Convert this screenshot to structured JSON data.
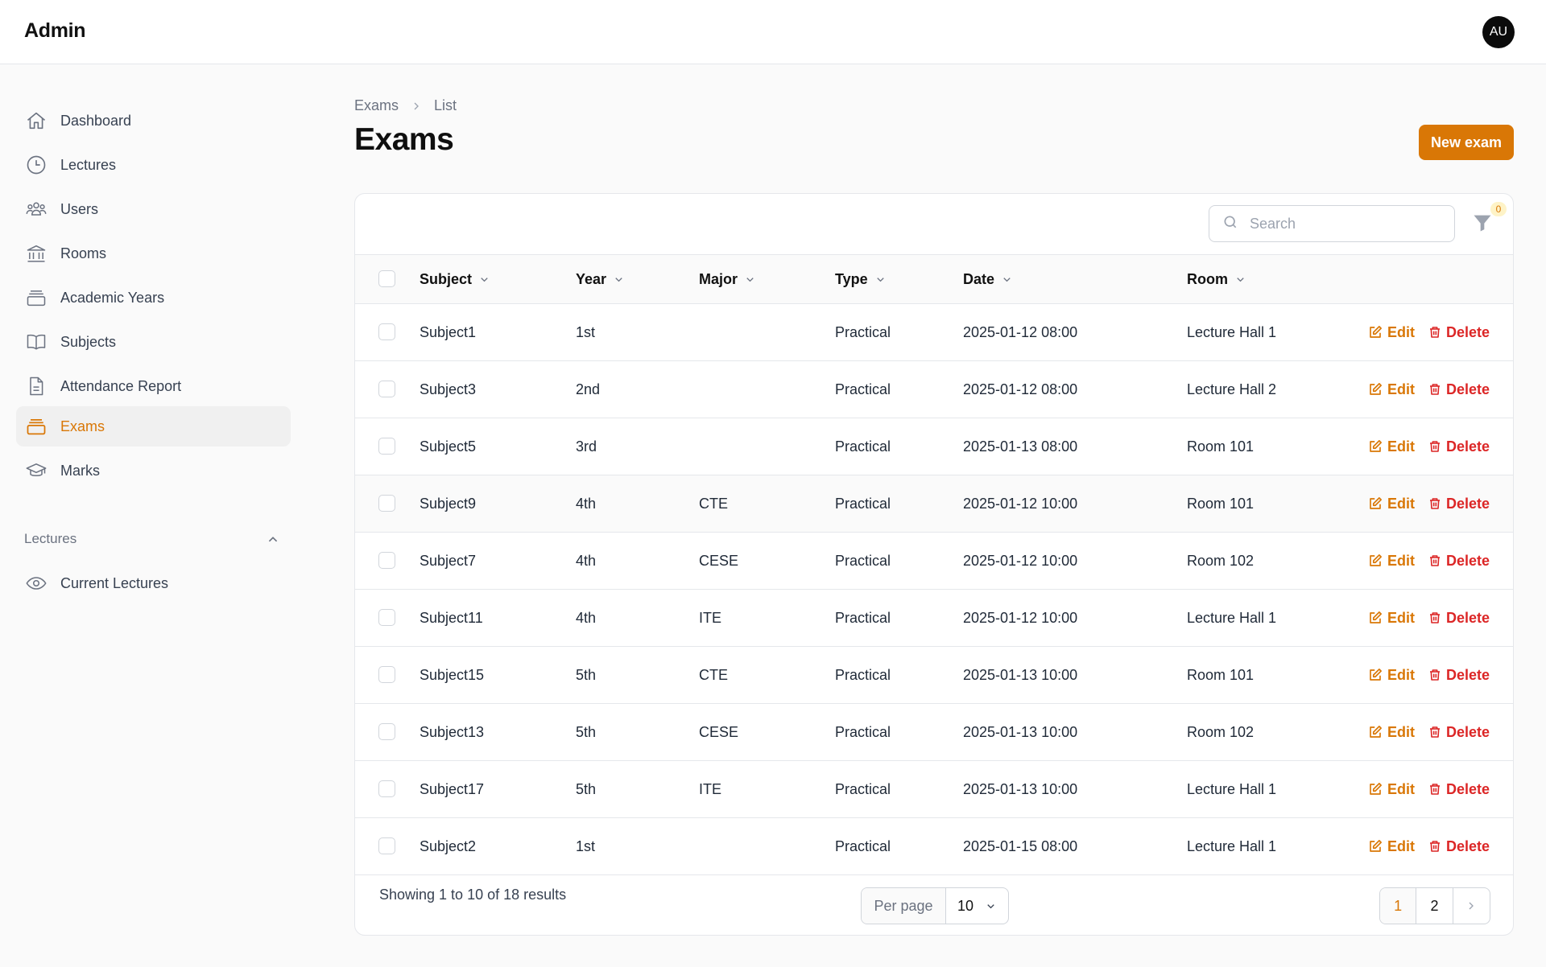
{
  "app": {
    "brand": "Admin",
    "avatar_initials": "AU",
    "accent": "#d97706"
  },
  "sidebar": {
    "items": [
      {
        "label": "Dashboard",
        "icon": "home-icon"
      },
      {
        "label": "Lectures",
        "icon": "clock-icon"
      },
      {
        "label": "Users",
        "icon": "users-icon"
      },
      {
        "label": "Rooms",
        "icon": "building-icon"
      },
      {
        "label": "Academic Years",
        "icon": "archive-icon"
      },
      {
        "label": "Subjects",
        "icon": "book-icon"
      },
      {
        "label": "Attendance Report",
        "icon": "document-icon"
      },
      {
        "label": "Exams",
        "icon": "archive-icon",
        "active": true
      },
      {
        "label": "Marks",
        "icon": "graduation-cap-icon"
      }
    ],
    "group": {
      "label": "Lectures",
      "items": [
        {
          "label": "Current Lectures",
          "icon": "eye-icon"
        }
      ]
    }
  },
  "breadcrumb": {
    "parent": "Exams",
    "current": "List"
  },
  "page": {
    "title": "Exams",
    "new_button": "New exam"
  },
  "table": {
    "search_placeholder": "Search",
    "filter_count": "0",
    "columns": [
      "Subject",
      "Year",
      "Major",
      "Type",
      "Date",
      "Room"
    ],
    "edit_label": "Edit",
    "delete_label": "Delete",
    "rows": [
      {
        "subject": "Subject1",
        "year": "1st",
        "major": "",
        "type": "Practical",
        "date": "2025-01-12 08:00",
        "room": "Lecture Hall 1"
      },
      {
        "subject": "Subject3",
        "year": "2nd",
        "major": "",
        "type": "Practical",
        "date": "2025-01-12 08:00",
        "room": "Lecture Hall 2"
      },
      {
        "subject": "Subject5",
        "year": "3rd",
        "major": "",
        "type": "Practical",
        "date": "2025-01-13 08:00",
        "room": "Room 101"
      },
      {
        "subject": "Subject9",
        "year": "4th",
        "major": "CTE",
        "type": "Practical",
        "date": "2025-01-12 10:00",
        "room": "Room 101"
      },
      {
        "subject": "Subject7",
        "year": "4th",
        "major": "CESE",
        "type": "Practical",
        "date": "2025-01-12 10:00",
        "room": "Room 102"
      },
      {
        "subject": "Subject11",
        "year": "4th",
        "major": "ITE",
        "type": "Practical",
        "date": "2025-01-12 10:00",
        "room": "Lecture Hall 1"
      },
      {
        "subject": "Subject15",
        "year": "5th",
        "major": "CTE",
        "type": "Practical",
        "date": "2025-01-13 10:00",
        "room": "Room 101"
      },
      {
        "subject": "Subject13",
        "year": "5th",
        "major": "CESE",
        "type": "Practical",
        "date": "2025-01-13 10:00",
        "room": "Room 102"
      },
      {
        "subject": "Subject17",
        "year": "5th",
        "major": "ITE",
        "type": "Practical",
        "date": "2025-01-13 10:00",
        "room": "Lecture Hall 1"
      },
      {
        "subject": "Subject2",
        "year": "1st",
        "major": "",
        "type": "Practical",
        "date": "2025-01-15 08:00",
        "room": "Lecture Hall 1"
      }
    ],
    "footer": {
      "summary": "Showing 1 to 10 of 18 results",
      "per_page_label": "Per page",
      "per_page_value": "10",
      "pages": [
        "1",
        "2"
      ],
      "current_page": "1"
    }
  }
}
